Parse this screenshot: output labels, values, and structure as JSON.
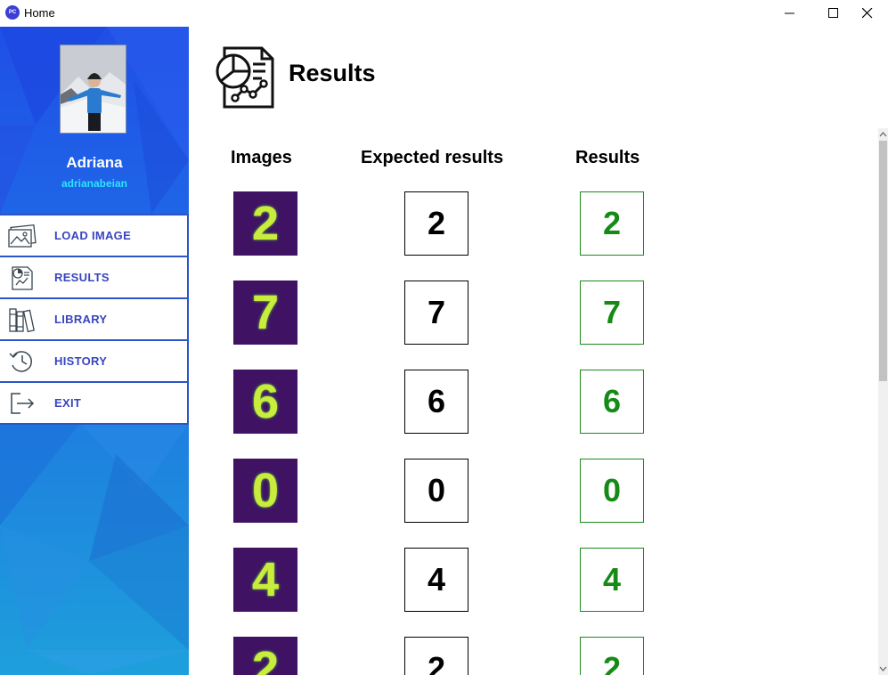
{
  "window": {
    "title": "Home",
    "icon_text": "PC"
  },
  "user": {
    "name": "Adriana",
    "handle": "adrianabeian"
  },
  "menu": [
    {
      "label": "LOAD IMAGE",
      "icon": "image-icon"
    },
    {
      "label": "RESULTS",
      "icon": "report-icon"
    },
    {
      "label": "LIBRARY",
      "icon": "books-icon"
    },
    {
      "label": "HISTORY",
      "icon": "history-icon"
    },
    {
      "label": "EXIT",
      "icon": "exit-icon"
    }
  ],
  "page": {
    "title": "Results",
    "icon": "report-chart-icon"
  },
  "table": {
    "headers": {
      "images": "Images",
      "expected": "Expected results",
      "results": "Results"
    },
    "rows": [
      {
        "image_digit": "2",
        "expected": "2",
        "result": "2"
      },
      {
        "image_digit": "7",
        "expected": "7",
        "result": "7"
      },
      {
        "image_digit": "6",
        "expected": "6",
        "result": "6"
      },
      {
        "image_digit": "0",
        "expected": "0",
        "result": "0"
      },
      {
        "image_digit": "4",
        "expected": "4",
        "result": "4"
      },
      {
        "image_digit": "2",
        "expected": "2",
        "result": "2"
      }
    ]
  },
  "colors": {
    "sidebar_blue": "#1f5ee6",
    "menu_text": "#3845c0",
    "handle_cyan": "#2ee3ff",
    "result_green": "#168a16",
    "digit_bg": "#3f1264"
  }
}
